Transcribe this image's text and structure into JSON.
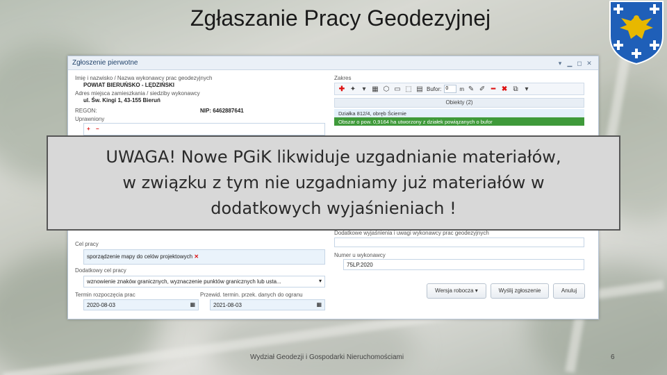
{
  "slide": {
    "title": "Zgłaszanie Pracy Geodezyjnej",
    "footer": "Wydział Geodezji i Gospodarki Nieruchomościami",
    "page_number": "6"
  },
  "window": {
    "title": "Zgłoszenie pierwotne",
    "controls": [
      "▾",
      "▁",
      "◻",
      "✕"
    ]
  },
  "form": {
    "contractor_label": "Imię i nazwisko / Nazwa wykonawcy prac geodezyjnych",
    "contractor_value": "POWIAT BIERUŃSKO - LĘDZIŃSKI",
    "address_label": "Adres miejsca zamieszkania / siedziby wykonawcy",
    "address_value": "ul. Św. Kingi 1, 43-155 Bieruń",
    "regon_label": "REGON:",
    "nip_label": "NIP: 6462887641",
    "permissions_label": "Uprawniony",
    "purpose_label": "Cel pracy",
    "purpose_value": "sporządzenie mapy do celów projektowych",
    "additional_purpose_label": "Dodatkowy cel pracy",
    "additional_purpose_value": "wznowienie znaków granicznych, wyznaczenie punktów granicznych lub usta...",
    "start_date_label": "Termin rozpoczęcia prac",
    "start_date_value": "2020-08-03",
    "end_date_label": "Przewid. termin. przek. danych do ogranu",
    "end_date_value": "2021-08-03",
    "scope_label": "Zakres",
    "buffer_label": "Bufor:",
    "buffer_value": "0",
    "buffer_unit": "m",
    "objects_header": "Obiekty (2)",
    "object_rows": [
      "Działka 812/4, obręb Ściernie",
      "Obszar o pow. 0,9164 ha utworzony z działek powiązanych o bufor"
    ],
    "notes_label": "Dodatkowe wyjaśnienia i uwagi wykonawcy prac geodezyjnych",
    "contractor_number_label": "Numer u wykonawcy",
    "contractor_number_value": "75LP.2020",
    "draft_button": "Wersja robocza ▾",
    "send_button": "Wyślij zgłoszenie",
    "cancel_button": "Anuluj"
  },
  "warning": {
    "line1": "UWAGA! Nowe PGiK likwiduje uzgadnianie materiałów,",
    "line2": "w związku z tym nie uzgadniamy już materiałów w",
    "line3": "dodatkowych wyjaśnieniach !"
  },
  "colors": {
    "selected_row": "#3f9a3a",
    "field_bg": "#eaf3fb",
    "crest_blue": "#1f5fb8",
    "crest_gold": "#e8b800"
  },
  "icons": [
    "plus-icon",
    "minus-icon",
    "close-icon",
    "calendar-icon",
    "dropdown-icon",
    "eagle-crest"
  ]
}
